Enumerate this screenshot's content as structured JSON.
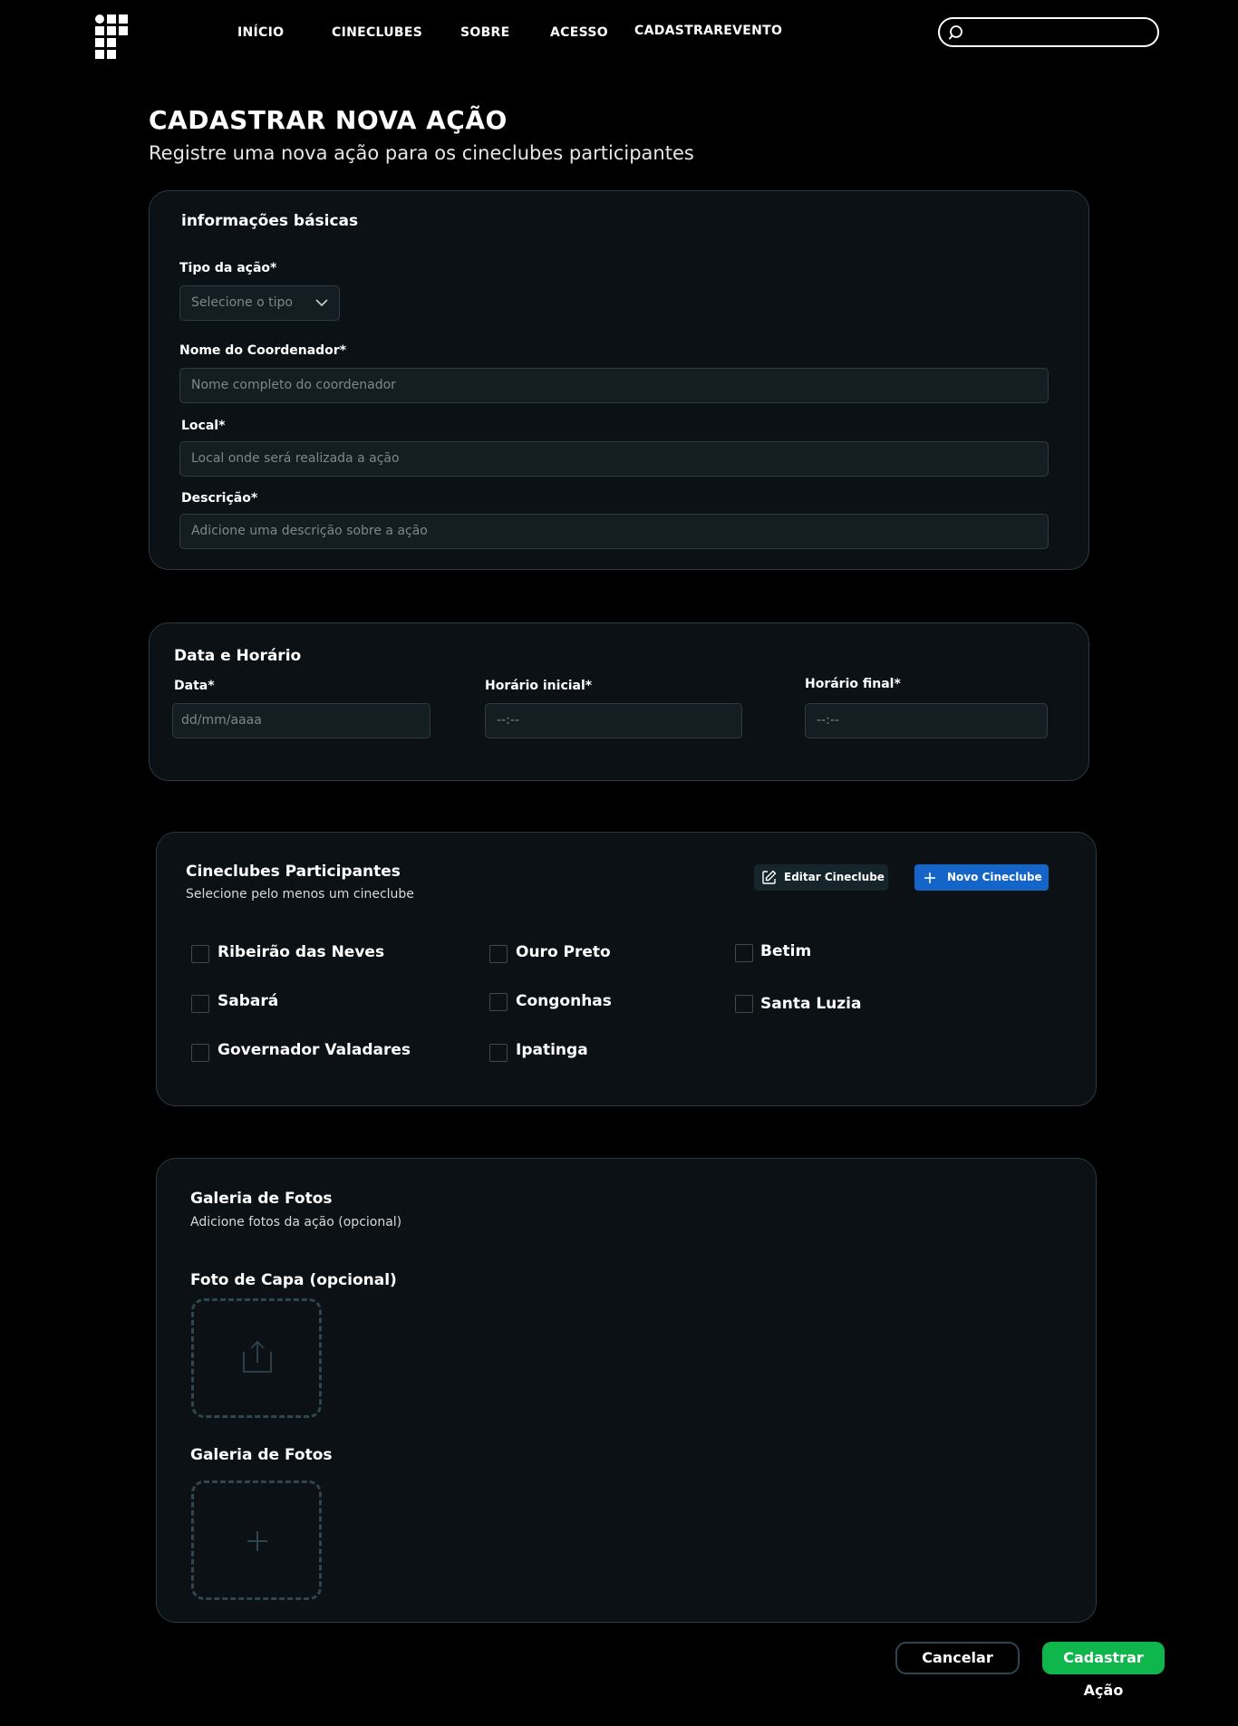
{
  "nav": {
    "items": [
      "INÍCIO",
      "CINECLUBES",
      "SOBRE",
      "ACESSO",
      "CADASTRAREVENTO"
    ]
  },
  "search": {
    "placeholder": "",
    "icon": "search-icon"
  },
  "page": {
    "title": "CADASTRAR NOVA AÇÃO",
    "subtitle": "Registre uma nova ação para os cineclubes participantes"
  },
  "basic_info": {
    "title": "informações básicas",
    "type_label": "Tipo da ação*",
    "type_value": "Selecione o tipo",
    "coordinator_label": "Nome do Coordenador*",
    "coordinator_placeholder": "Nome completo do coordenador",
    "location_label": "Local*",
    "location_placeholder": "Local onde será realizada a ação",
    "description_label": "Descrição*",
    "description_placeholder": "Adicione uma descrição sobre a ação"
  },
  "datetime": {
    "title": "Data e Horário",
    "date_label": "Data*",
    "date_placeholder": "dd/mm/aaaa",
    "start_label": "Horário inicial*",
    "start_placeholder": "--:--",
    "end_label": "Horário final*",
    "end_placeholder": "--:--"
  },
  "cineclubes": {
    "title": "Cineclubes Participantes",
    "subtitle": "Selecione pelo menos um cineclube",
    "edit_button": "Editar Cineclube",
    "new_button": "Novo Cineclube",
    "options": [
      "Ribeirão das Neves",
      "Ouro Preto",
      "Betim",
      "Sabará",
      "Congonhas",
      "Santa Luzia",
      "Governador Valadares",
      "Ipatinga"
    ]
  },
  "gallery": {
    "title": "Galeria de Fotos",
    "subtitle": "Adicione fotos da ação (opcional)",
    "cover_label": "Foto de Capa (opcional)",
    "gallery_label": "Galeria de Fotos"
  },
  "actions": {
    "cancel": "Cancelar",
    "submit": "Cadastrar Ação"
  },
  "colors": {
    "background": "#000000",
    "card": "#0b1114",
    "primary_blue": "#1565c9",
    "submit_green": "#0fb64c"
  }
}
